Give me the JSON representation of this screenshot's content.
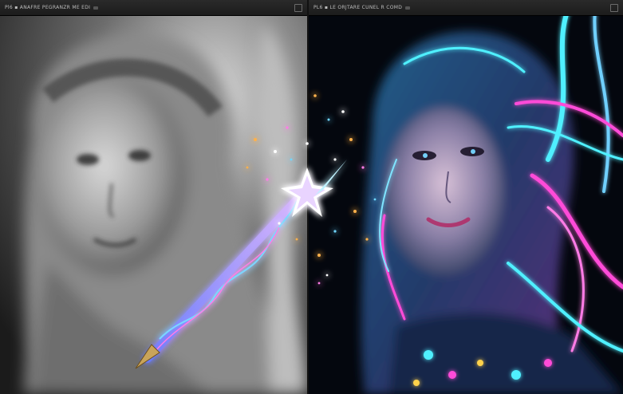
{
  "left_panel": {
    "title": "Pl6 ▪ ANAFRE PEGRANZR ME EDI",
    "buttons": [
      "",
      ""
    ]
  },
  "right_panel": {
    "title": "PL6 ▪ LE ORJTARE CUNEL R COMD",
    "buttons": [
      "",
      ""
    ]
  },
  "colors": {
    "accent_cyan": "#4ff0ff",
    "accent_magenta": "#ff4bd8",
    "wand_glow": "#b98bff",
    "bg_dark": "#05080f"
  }
}
